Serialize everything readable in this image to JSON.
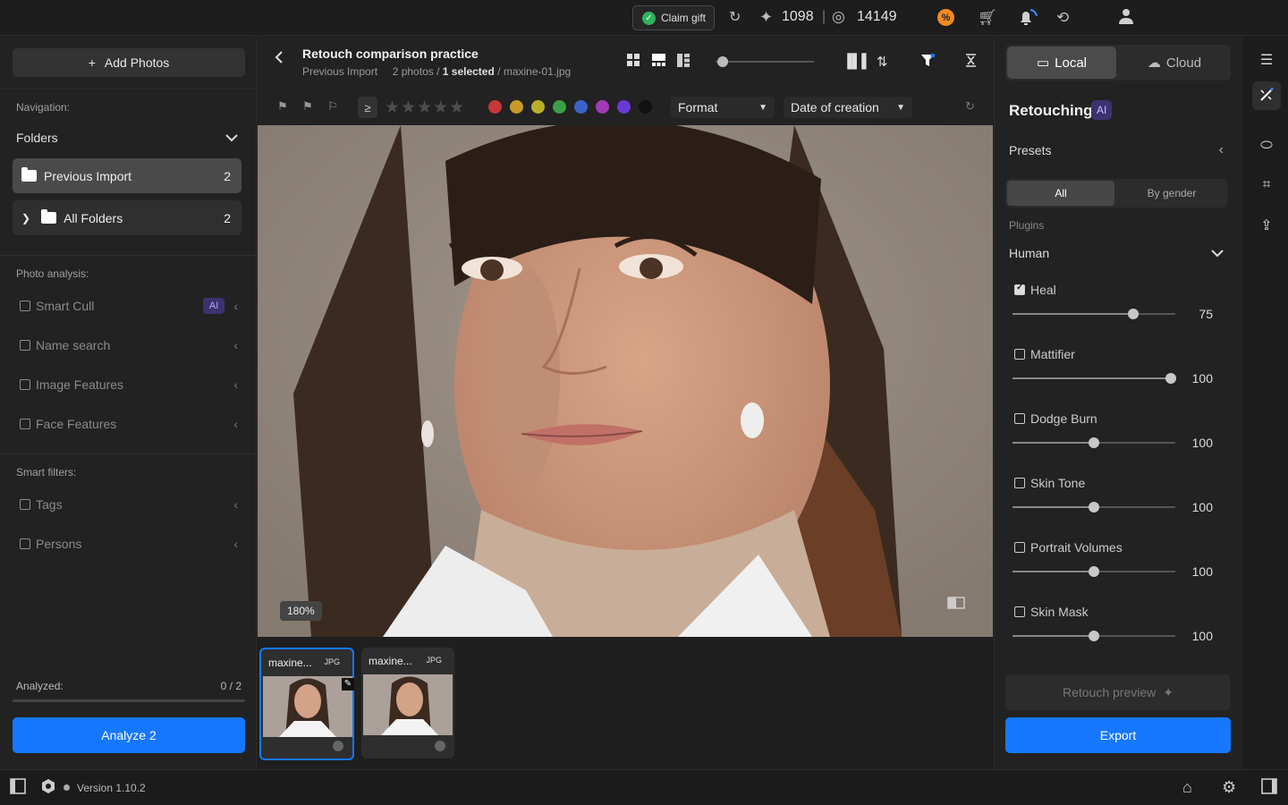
{
  "topbar": {
    "claim_gift": "Claim gift",
    "credits_1": "1098",
    "separator": "|",
    "credits_2": "14149"
  },
  "left": {
    "add_photos": "Add Photos",
    "nav_label": "Navigation:",
    "folders": "Folders",
    "folder_items": [
      {
        "label": "Previous Import",
        "count": "2"
      },
      {
        "label": "All Folders",
        "count": "2"
      }
    ],
    "photo_analysis": "Photo analysis:",
    "analysis_filters": [
      "Smart Cull",
      "Name search",
      "Image Features",
      "Face Features"
    ],
    "ai_badge": "AI",
    "smart_filters": "Smart filters:",
    "smart_items": [
      "Tags",
      "Persons"
    ],
    "analyzed_label": "Analyzed:",
    "analyzed_value": "0 / 2",
    "analyze_button": "Analyze 2"
  },
  "center": {
    "title": "Retouch comparison practice",
    "breadcrumb": "Previous Import",
    "photos_count": "2 photos /",
    "selected": "1 selected",
    "filename": "/ maxine-01.jpg",
    "ge_symbol": "≥",
    "stars": "★★★★★",
    "color_labels": [
      "#c8373a",
      "#c99a2a",
      "#b9b02a",
      "#3aa048",
      "#3b63c8",
      "#a23ab8",
      "#6a3ad8",
      "#111111"
    ],
    "format_dropdown": "Format",
    "sort_dropdown": "Date of creation",
    "zoom": "180%",
    "thumbnails": [
      {
        "name": "maxine...",
        "format": "JPG"
      },
      {
        "name": "maxine...",
        "format": "JPG"
      }
    ]
  },
  "right": {
    "local": "Local",
    "cloud": "Cloud",
    "retouching": "Retouching",
    "ai": "AI",
    "presets": "Presets",
    "seg_all": "All",
    "seg_gender": "By gender",
    "plugins_label": "Plugins",
    "plugin_group": "Human",
    "plugins": [
      {
        "name": "Heal",
        "value": "75",
        "checked": true,
        "level": 0.74
      },
      {
        "name": "Mattifier",
        "value": "100",
        "checked": false,
        "level": 0.97
      },
      {
        "name": "Dodge Burn",
        "value": "100",
        "checked": false,
        "level": 0.5
      },
      {
        "name": "Skin Tone",
        "value": "100",
        "checked": false,
        "level": 0.5
      },
      {
        "name": "Portrait Volumes",
        "value": "100",
        "checked": false,
        "level": 0.5
      },
      {
        "name": "Skin Mask",
        "value": "100",
        "checked": false,
        "level": 0.5
      }
    ],
    "retouch_preview": "Retouch preview",
    "export": "Export"
  },
  "bottom": {
    "version": "Version 1.10.2"
  }
}
